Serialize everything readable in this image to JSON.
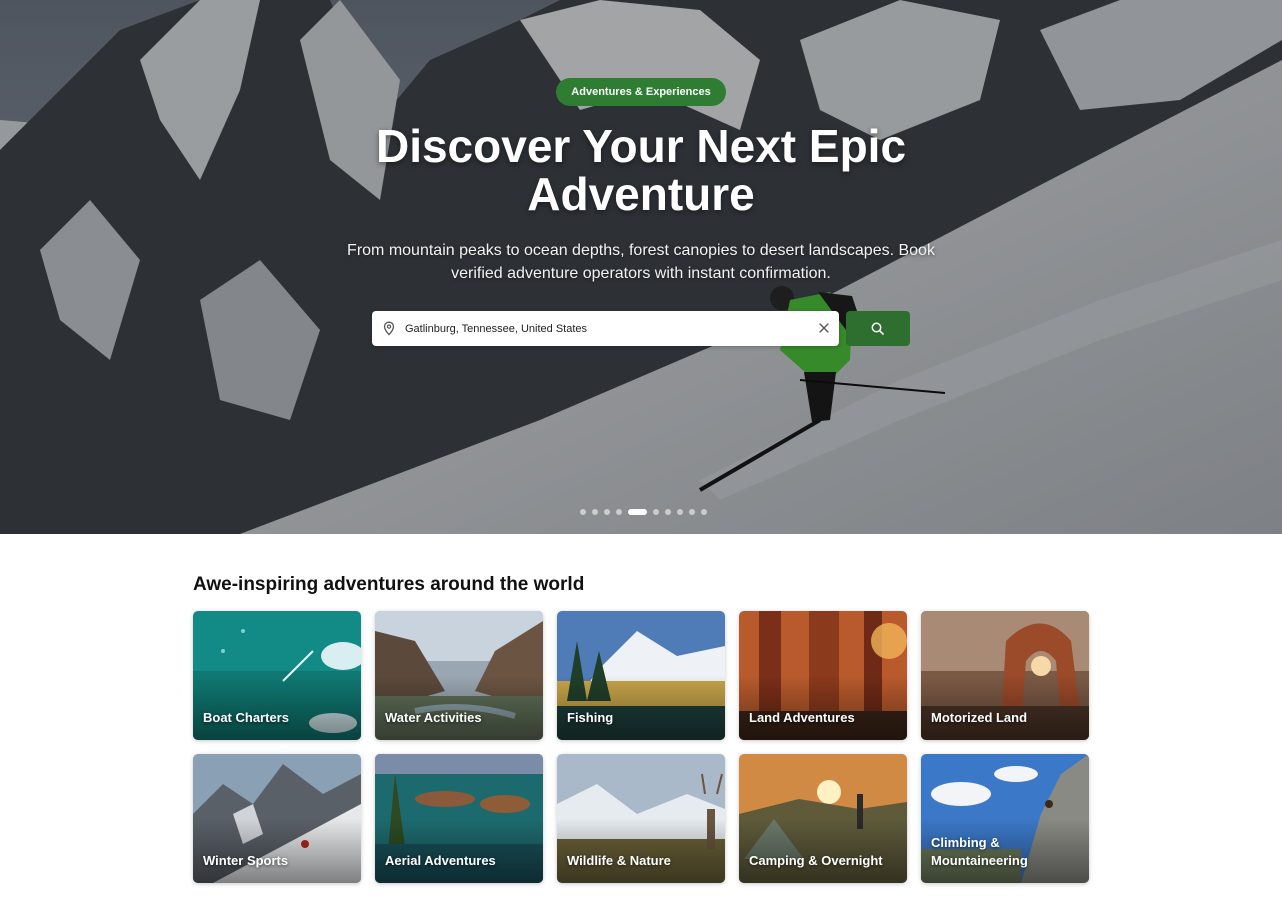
{
  "hero": {
    "badge": "Adventures & Experiences",
    "title": "Discover Your Next Epic Adventure",
    "subtitle": "From mountain peaks to ocean depths, forest canopies to desert landscapes. Book verified adventure operators with instant confirmation.",
    "search": {
      "value": "Gatlinburg, Tennessee, United States"
    },
    "carousel": {
      "total": 10,
      "active_index": 4
    }
  },
  "categories_section": {
    "title": "Awe-inspiring adventures around the world",
    "cards": [
      {
        "label": "Boat Charters"
      },
      {
        "label": "Water Activities"
      },
      {
        "label": "Fishing"
      },
      {
        "label": "Land Adventures"
      },
      {
        "label": "Motorized Land"
      },
      {
        "label": "Winter Sports"
      },
      {
        "label": "Aerial Adventures"
      },
      {
        "label": "Wildlife & Nature"
      },
      {
        "label": "Camping & Overnight"
      },
      {
        "label": "Climbing & Mountaineering"
      }
    ]
  },
  "colors": {
    "accent": "#2e7d32",
    "button": "#2e6f30"
  },
  "icons": {
    "search_field": "map-pin-icon",
    "clear": "close-icon",
    "submit": "search-icon"
  }
}
